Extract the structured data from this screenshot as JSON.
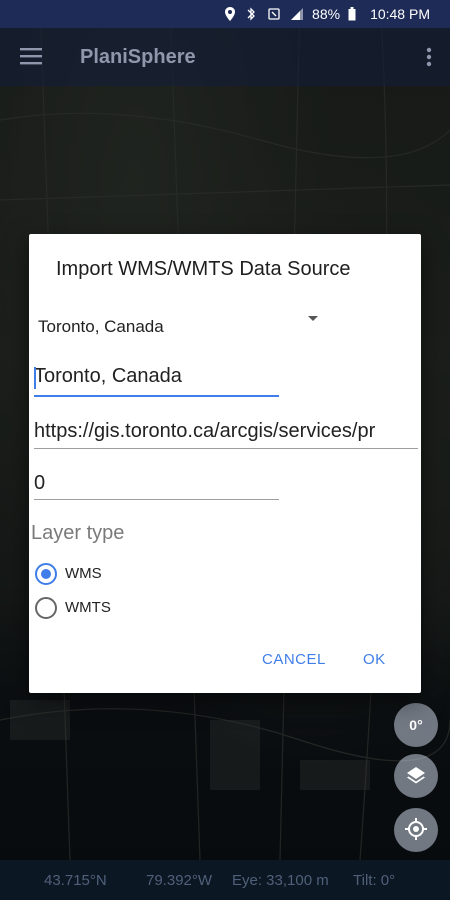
{
  "status_bar": {
    "battery": "88%",
    "time": "10:48 PM",
    "icons": [
      "location-icon",
      "bluetooth-icon",
      "nfc-icon",
      "signal-icon",
      "battery-icon"
    ]
  },
  "app_bar": {
    "title": "PlaniSphere",
    "menu_icon": "hamburger-menu-icon",
    "overflow_icon": "more-vert-icon"
  },
  "dialog": {
    "title": "Import WMS/WMTS Data Source",
    "source_select": {
      "selected": "Toronto, Canada"
    },
    "name_field": {
      "value": "Toronto, Canada"
    },
    "url_field": {
      "value": "https://gis.toronto.ca/arcgis/services/pr"
    },
    "index_field": {
      "value": "0"
    },
    "layer_type": {
      "label": "Layer type",
      "options": [
        {
          "label": "WMS",
          "checked": true
        },
        {
          "label": "WMTS",
          "checked": false
        }
      ]
    },
    "buttons": {
      "cancel": "CANCEL",
      "ok": "OK"
    }
  },
  "map_controls": {
    "compass": "0°",
    "layers_icon": "layers-icon",
    "locate_icon": "my-location-icon"
  },
  "info_bar": {
    "lat": "43.715°N",
    "lon": "79.392°W",
    "eye": "Eye: 33,100 m",
    "tilt": "Tilt:  0°"
  },
  "colors": {
    "accent": "#3f7ee8",
    "status_bar": "#1e2b57",
    "dialog_bg": "#ffffff"
  }
}
